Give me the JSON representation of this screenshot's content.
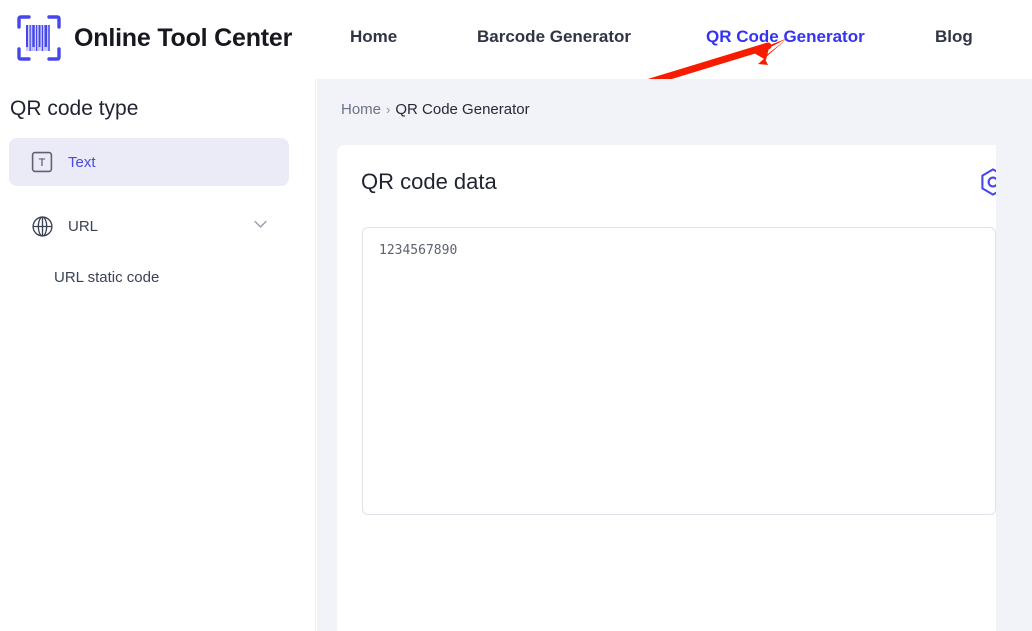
{
  "header": {
    "brand_name": "Online Tool Center",
    "logo_icon": "barcode-scanner-icon",
    "nav": [
      {
        "label": "Home",
        "active": false
      },
      {
        "label": "Barcode Generator",
        "active": false
      },
      {
        "label": "QR Code Generator",
        "active": true
      },
      {
        "label": "Blog",
        "active": false
      }
    ],
    "annotation": {
      "type": "red-arrow",
      "points_to": "QR Code Generator",
      "color": "#f71c० 0"
    }
  },
  "sidebar": {
    "title": "QR code type",
    "items": [
      {
        "label": "Text",
        "icon": "text-box-icon",
        "selected": true
      },
      {
        "label": "URL",
        "icon": "globe-icon",
        "selected": false,
        "expandable": true,
        "chevron": "chevron-down-icon"
      }
    ],
    "sub_items": [
      {
        "label": "URL static code"
      }
    ]
  },
  "breadcrumb": {
    "home": "Home",
    "separator": "›",
    "current": "QR Code Generator"
  },
  "card": {
    "title": "QR code data",
    "settings_icon": "hexagon-target-icon",
    "textarea": {
      "value": "1234567890",
      "placeholder": ""
    }
  },
  "colors": {
    "accent": "#3434f0",
    "brand_dark": "#17171f",
    "selected_bg": "#ebebf7",
    "content_bg": "#f2f3f8",
    "annotation_red": "#f71c00"
  }
}
